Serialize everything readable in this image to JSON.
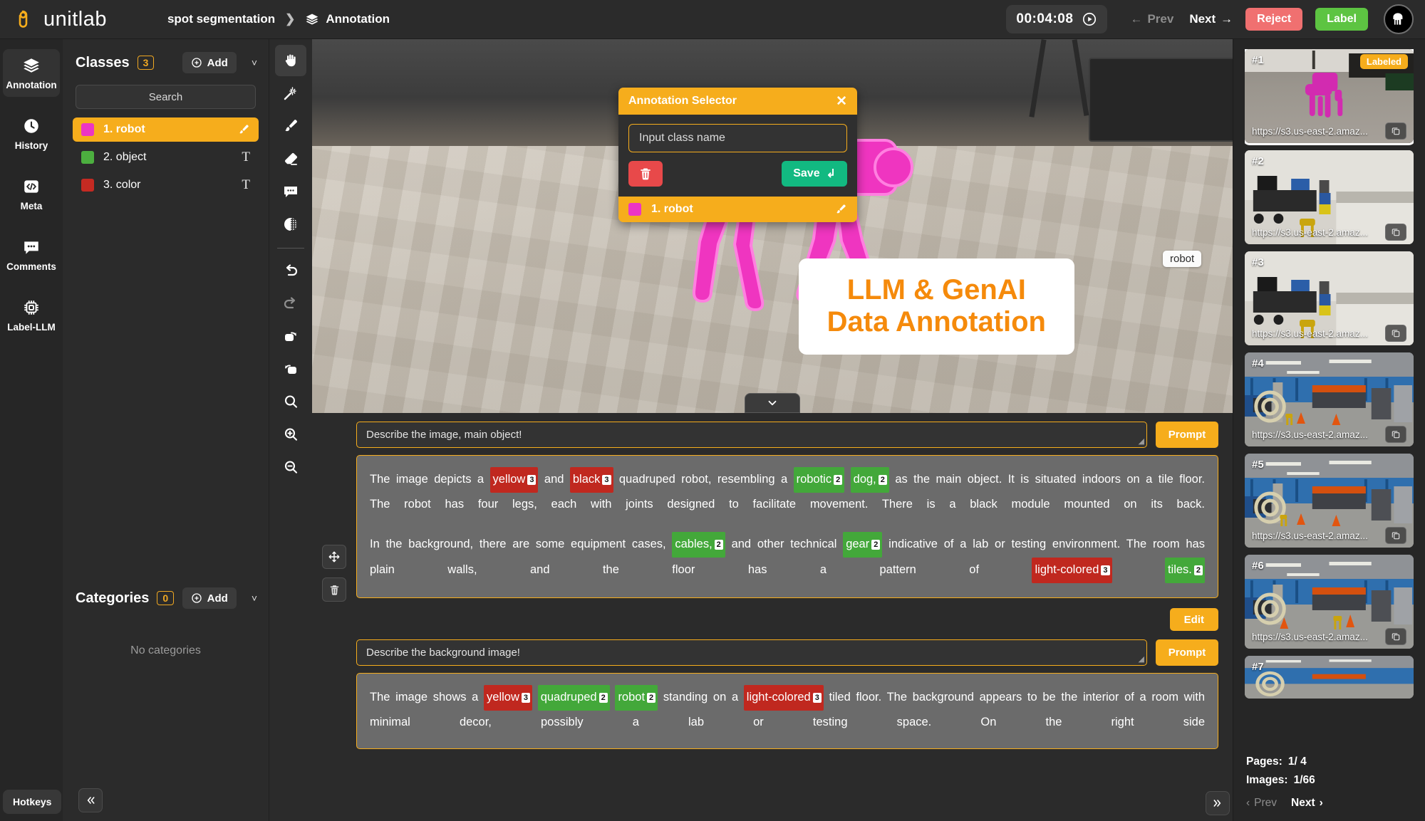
{
  "header": {
    "brand": "unitlab",
    "breadcrumb_project": "spot segmentation",
    "breadcrumb_section": "Annotation",
    "timer": "00:04:08",
    "prev_label": "Prev",
    "next_label": "Next",
    "reject_label": "Reject",
    "label_label": "Label"
  },
  "rail": {
    "items": [
      {
        "label": "Annotation",
        "icon": "layers-icon",
        "active": true
      },
      {
        "label": "History",
        "icon": "clock-icon",
        "active": false
      },
      {
        "label": "Meta",
        "icon": "code-icon",
        "active": false
      },
      {
        "label": "Comments",
        "icon": "comment-icon",
        "active": false
      },
      {
        "label": "Label-LLM",
        "icon": "chip-icon",
        "active": false
      }
    ],
    "hotkeys": "Hotkeys"
  },
  "classes_panel": {
    "title": "Classes",
    "count": "3",
    "add_label": "Add",
    "search_placeholder": "Search",
    "items": [
      {
        "label": "1. robot",
        "color": "#ec35c4",
        "selected": true,
        "tool": "brush"
      },
      {
        "label": "2. object",
        "color": "#4caf3f",
        "selected": false,
        "tool": "text"
      },
      {
        "label": "3. color",
        "color": "#c42a22",
        "selected": false,
        "tool": "text"
      }
    ]
  },
  "categories_panel": {
    "title": "Categories",
    "count": "0",
    "add_label": "Add",
    "empty_text": "No categories"
  },
  "tools": [
    {
      "name": "hand-tool",
      "active": true
    },
    {
      "name": "magic-wand-tool",
      "active": false
    },
    {
      "name": "brush-tool",
      "active": false
    },
    {
      "name": "eraser-tool",
      "active": false
    },
    {
      "name": "comment-tool",
      "active": false
    },
    {
      "name": "contrast-tool",
      "active": false
    },
    {
      "name": "undo-tool",
      "active": false
    },
    {
      "name": "redo-tool",
      "active": false
    },
    {
      "name": "rotate-right-tool",
      "active": false
    },
    {
      "name": "rotate-left-tool",
      "active": false
    },
    {
      "name": "search-tool",
      "active": false
    },
    {
      "name": "zoom-in-tool",
      "active": false
    },
    {
      "name": "zoom-out-tool",
      "active": false
    }
  ],
  "annotation_selector": {
    "title": "Annotation Selector",
    "input_placeholder": "Input class name",
    "save_label": "Save",
    "row_label": "1. robot",
    "row_color": "#ec35c4"
  },
  "canvas": {
    "object_label": "robot",
    "promo_line1": "LLM & GenAI",
    "promo_line2": "Data Annotation",
    "promo_color": "#f58a0b"
  },
  "llm_blocks": [
    {
      "prompt_value": "Describe the image, main object!",
      "prompt_button": "Prompt",
      "edit_button": "Edit",
      "paragraphs": [
        [
          {
            "t": "The image depicts a "
          },
          {
            "t": "yellow",
            "tag": "red",
            "n": "3"
          },
          {
            "t": " and "
          },
          {
            "t": "black",
            "tag": "red",
            "n": "3"
          },
          {
            "t": " quadruped robot, resembling a "
          },
          {
            "t": "robotic",
            "tag": "green",
            "n": "2"
          },
          {
            "t": " "
          },
          {
            "t": "dog,",
            "tag": "green",
            "n": "2"
          },
          {
            "t": " as the main object. It is situated indoors on a tile floor. The robot has four legs, each with joints designed to facilitate movement. There is a black module mounted on its back."
          }
        ],
        [
          {
            "t": "In the background, there are some equipment cases, "
          },
          {
            "t": "cables,",
            "tag": "green",
            "n": "2"
          },
          {
            "t": " and other technical "
          },
          {
            "t": "gear",
            "tag": "green",
            "n": "2"
          },
          {
            "t": " indicative of a lab or testing environment. The room has plain walls, and the floor has a pattern of "
          },
          {
            "t": "light-colored",
            "tag": "red",
            "n": "3"
          },
          {
            "t": " "
          },
          {
            "t": "tiles.",
            "tag": "green",
            "n": "2"
          }
        ]
      ]
    },
    {
      "prompt_value": "Describe the background image!",
      "prompt_button": "Prompt",
      "paragraphs": [
        [
          {
            "t": "The image shows a "
          },
          {
            "t": "yellow",
            "tag": "red",
            "n": "3"
          },
          {
            "t": " "
          },
          {
            "t": "quadruped",
            "tag": "green",
            "n": "2"
          },
          {
            "t": " "
          },
          {
            "t": "robot",
            "tag": "green",
            "n": "2"
          },
          {
            "t": " standing on a "
          },
          {
            "t": "light-colored",
            "tag": "red",
            "n": "3"
          },
          {
            "t": " tiled floor. The background appears to be the interior of a room with minimal decor, possibly a lab or testing space. On the right side"
          }
        ]
      ]
    }
  ],
  "thumbs": {
    "items": [
      {
        "num": "#1",
        "url": "https://s3.us-east-2.amaz...",
        "badge": "Labeled",
        "selected": true,
        "scene": "robot-magenta"
      },
      {
        "num": "#2",
        "url": "https://s3.us-east-2.amaz...",
        "badge": "",
        "selected": false,
        "scene": "lab-room"
      },
      {
        "num": "#3",
        "url": "https://s3.us-east-2.amaz...",
        "badge": "",
        "selected": false,
        "scene": "lab-room"
      },
      {
        "num": "#4",
        "url": "https://s3.us-east-2.amaz...",
        "badge": "",
        "selected": false,
        "scene": "warehouse"
      },
      {
        "num": "#5",
        "url": "https://s3.us-east-2.amaz...",
        "badge": "",
        "selected": false,
        "scene": "warehouse"
      },
      {
        "num": "#6",
        "url": "https://s3.us-east-2.amaz...",
        "badge": "",
        "selected": false,
        "scene": "warehouse"
      },
      {
        "num": "#7",
        "url": "",
        "badge": "",
        "selected": false,
        "scene": "warehouse"
      }
    ],
    "pages_label": "Pages:",
    "pages_value": "1/ 4",
    "images_label": "Images:",
    "images_value": "1/66",
    "prev_label": "Prev",
    "next_label": "Next"
  },
  "colors": {
    "accent": "#f6ad1c",
    "reject": "#f07070",
    "label": "#5dc442",
    "save": "#12b981",
    "delete": "#e8494a",
    "tag_red": "#c0281f",
    "tag_green": "#43a83a"
  }
}
